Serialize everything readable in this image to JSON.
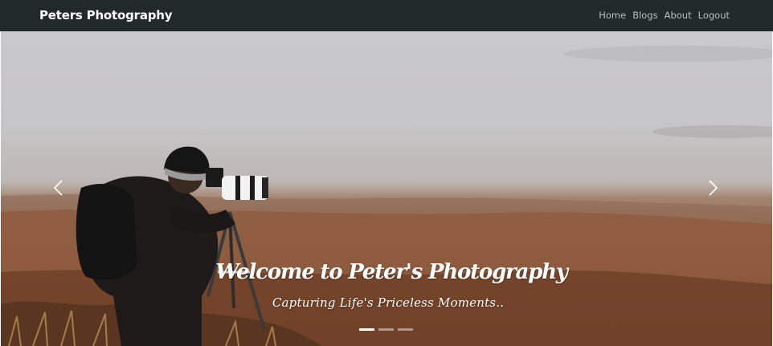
{
  "navbar": {
    "brand": "Peters Photography",
    "links": [
      {
        "label": "Home"
      },
      {
        "label": "Blogs"
      },
      {
        "label": "About"
      },
      {
        "label": "Logout"
      }
    ],
    "background": "#212a2a"
  },
  "carousel": {
    "prev_icon": "chevron-left-icon",
    "next_icon": "chevron-right-icon",
    "caption_title": "Welcome to Peter's Photography",
    "caption_subtitle": "Capturing Life's Priceless Moments..",
    "indicators": [
      {
        "active": true
      },
      {
        "active": false
      },
      {
        "active": false
      }
    ]
  }
}
